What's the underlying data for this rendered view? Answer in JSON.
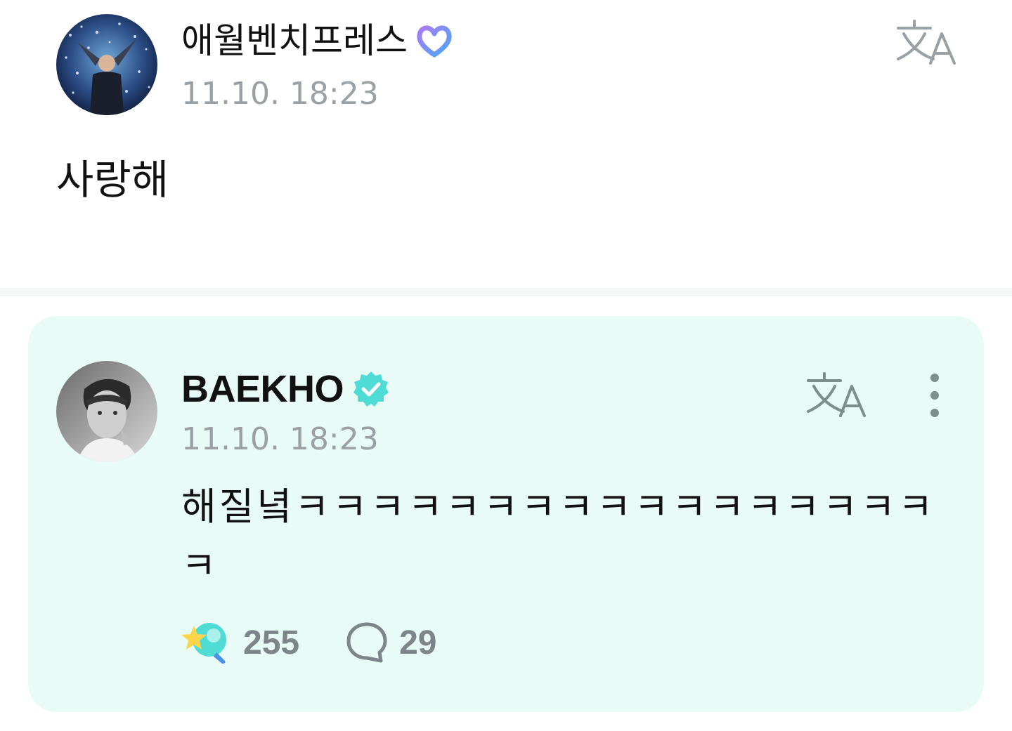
{
  "post": {
    "author": "애월벤치프레스",
    "timestamp": "11.10. 18:23",
    "body": "사랑해",
    "badge_icon": "fan-heart-badge-icon",
    "translate_icon": "translate-icon"
  },
  "reply": {
    "author": "BAEKHO",
    "timestamp": "11.10. 18:23",
    "body": "해질녘ㅋㅋㅋㅋㅋㅋㅋㅋㅋㅋㅋㅋㅋㅋㅋㅋㅋㅋ",
    "verified_icon": "verified-check-icon",
    "translate_icon": "translate-icon",
    "more_icon": "more-vertical-icon",
    "like_count": "255",
    "comment_count": "29",
    "like_icon": "star-wand-reaction-icon",
    "comment_icon": "comment-bubble-icon"
  },
  "colors": {
    "card_background": "#e8fbf6",
    "accent_teal": "#4fdcd4",
    "muted_icon": "#7c8f8c",
    "timestamp_gray": "#9aa0a4"
  }
}
